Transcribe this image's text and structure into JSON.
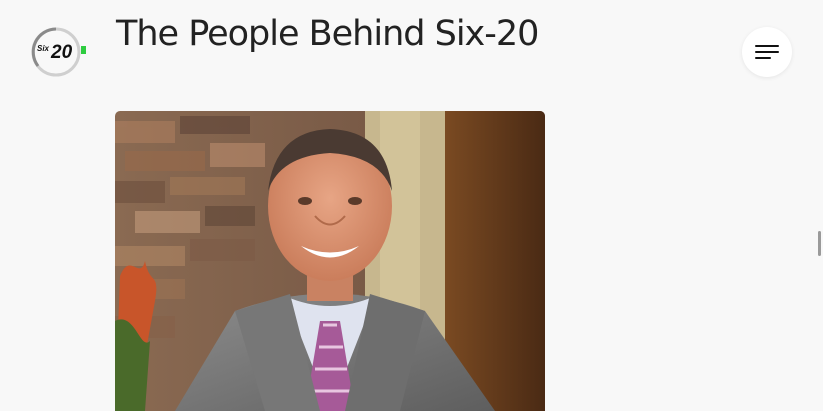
{
  "header": {
    "logo_text_small": "Six",
    "logo_text_big": "20",
    "title": "The People Behind Six-20"
  },
  "colors": {
    "accent": "#2ecc40",
    "text": "#222222",
    "background": "#f8f8f8"
  },
  "icons": {
    "menu": "hamburger-menu-icon"
  }
}
